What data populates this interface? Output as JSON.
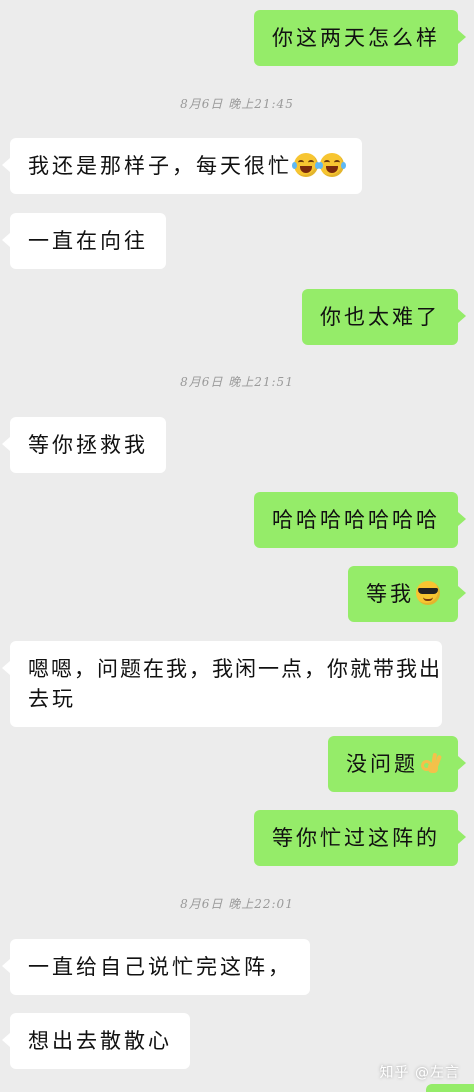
{
  "messages": [
    {
      "side": "out",
      "text": "你这两天怎么样"
    },
    {
      "timestamp": "8月6日 晚上21:45"
    },
    {
      "side": "in",
      "text": "我还是那样子，每天很忙",
      "emoji": [
        "laugh-cry",
        "laugh-cry"
      ]
    },
    {
      "side": "in",
      "text": "一直在向往"
    },
    {
      "side": "out",
      "text": "你也太难了"
    },
    {
      "timestamp": "8月6日 晚上21:51"
    },
    {
      "side": "in",
      "text": "等你拯救我"
    },
    {
      "side": "out",
      "text": "哈哈哈哈哈哈哈"
    },
    {
      "side": "out",
      "text": "等我",
      "emoji": [
        "sunglasses-face"
      ]
    },
    {
      "side": "in",
      "text_line1": "嗯嗯，问题在我，我闲一点，你就带我出",
      "text_line2": "去玩"
    },
    {
      "side": "out",
      "text": "没问题",
      "emoji": [
        "ok-hand"
      ]
    },
    {
      "side": "out",
      "text": "等你忙过这阵的"
    },
    {
      "timestamp": "8月6日 晚上22:01"
    },
    {
      "side": "in",
      "text": "一直给自己说忙完这阵，"
    },
    {
      "side": "in",
      "text": "想出去散散心"
    }
  ],
  "watermark": "知乎 @左言",
  "colors": {
    "background": "#ececec",
    "outgoing": "#95ec69",
    "incoming": "#ffffff"
  }
}
